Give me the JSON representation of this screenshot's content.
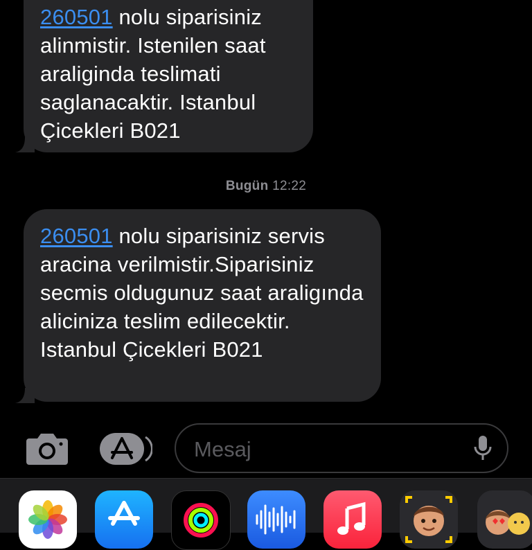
{
  "messages": [
    {
      "order_number": "260501",
      "text": " nolu siparisiniz alinmistir. Istenilen saat araliginda teslimati saglanacaktir. Istanbul Çicekleri B021"
    },
    {
      "order_number": "260501",
      "text": " nolu siparisiniz servis aracina verilmistir.Siparisiniz secmis oldugunuz saat araligında aliciniza teslim edilecektir. Istanbul Çicekleri B021"
    }
  ],
  "timestamp": {
    "day": "Bugün",
    "time": "12:22"
  },
  "composer": {
    "placeholder": "Mesaj",
    "camera_icon": "camera-icon",
    "apps_icon": "app-store-icon",
    "mic_icon": "microphone-icon"
  },
  "app_drawer": {
    "apps": [
      {
        "name": "photos-app-icon"
      },
      {
        "name": "app-store-app-icon"
      },
      {
        "name": "activity-app-icon"
      },
      {
        "name": "audio-message-app-icon"
      },
      {
        "name": "music-app-icon"
      },
      {
        "name": "memoji-app-icon"
      },
      {
        "name": "memoji-stickers-app-icon"
      }
    ]
  },
  "colors": {
    "background": "#000000",
    "bubble": "#262628",
    "link": "#3b8ef0",
    "timestamp": "#8e8e93"
  }
}
